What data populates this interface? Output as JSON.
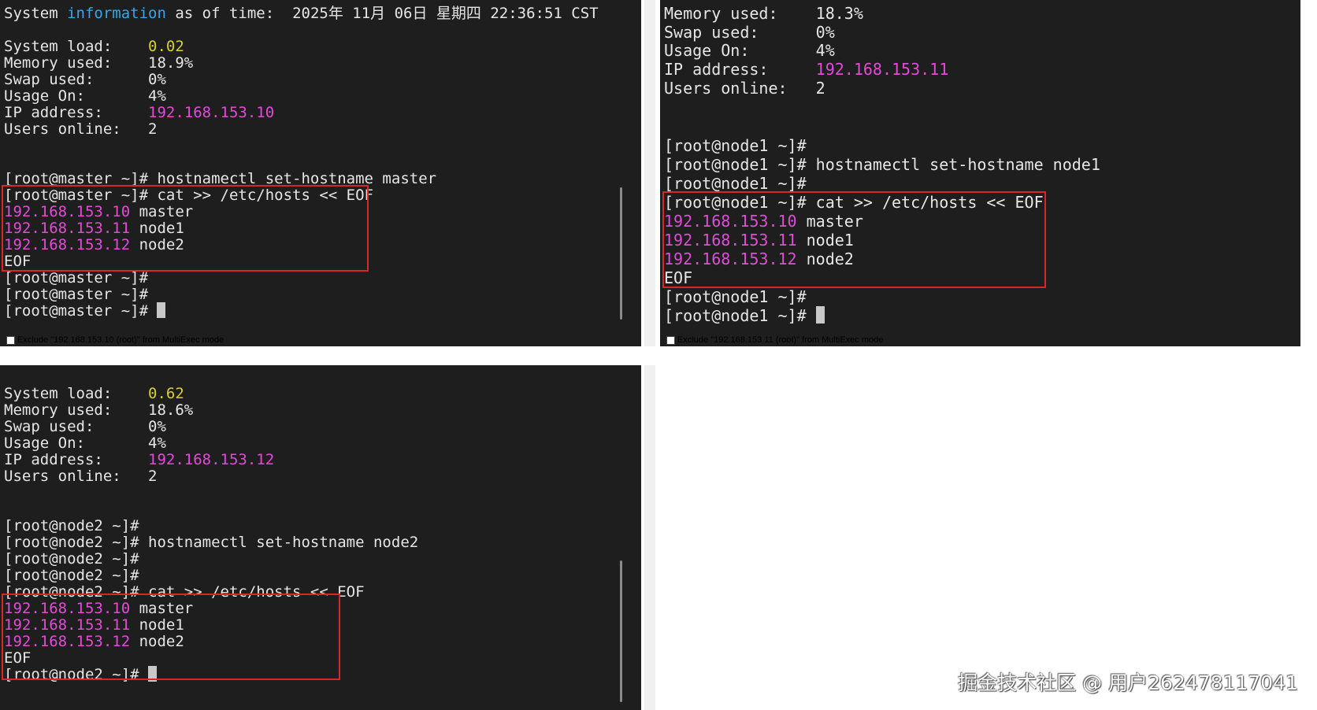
{
  "colors": {
    "terminal_bg": "#1e1e1e",
    "text": "#e6e6e6",
    "cyan": "#35a6e8",
    "yellow": "#d7d02e",
    "magenta": "#e24bd6",
    "highlight_box": "#d62828"
  },
  "terminals": {
    "master": {
      "sysinfo": {
        "prefix": "System ",
        "word": "information",
        "rest": " as of time:  2025年 11月 06日 星期四 22:36:51 CST"
      },
      "load_label": "System load:    ",
      "load_value": "0.02",
      "mem": "Memory used:    18.9%",
      "swap": "Swap used:      0%",
      "usage": "Usage On:       4%",
      "ip_label": "IP address:     ",
      "ip_value": "192.168.153.10",
      "users": "Users online:   2",
      "cmd_hostname": "[root@master ~]# hostnamectl set-hostname master",
      "cmd_cat": "[root@master ~]# cat >> /etc/hosts << EOF",
      "hosts": [
        {
          "ip": "192.168.153.10",
          "name": " master"
        },
        {
          "ip": "192.168.153.11",
          "name": " node1"
        },
        {
          "ip": "192.168.153.12",
          "name": " node2"
        }
      ],
      "eof": "EOF",
      "prompt": "[root@master ~]#",
      "prompt_last": "[root@master ~]# ",
      "exclude_label": "Exclude \"192.168.153.10 (root)\" from MultiExec mode"
    },
    "node1": {
      "mem": "Memory used:    18.3%",
      "swap": "Swap used:      0%",
      "usage": "Usage On:       4%",
      "ip_label": "IP address:     ",
      "ip_value": "192.168.153.11",
      "users": "Users online:   2",
      "prompt": "[root@node1 ~]#",
      "cmd_hostname": "[root@node1 ~]# hostnamectl set-hostname node1",
      "cmd_cat": "[root@node1 ~]# cat >> /etc/hosts << EOF",
      "hosts": [
        {
          "ip": "192.168.153.10",
          "name": " master"
        },
        {
          "ip": "192.168.153.11",
          "name": " node1"
        },
        {
          "ip": "192.168.153.12",
          "name": " node2"
        }
      ],
      "eof": "EOF",
      "prompt_last": "[root@node1 ~]# ",
      "exclude_label": "Exclude \"192.168.153.11 (root)\" from MultiExec mode"
    },
    "node2": {
      "load_label": "System load:    ",
      "load_value": "0.62",
      "mem": "Memory used:    18.6%",
      "swap": "Swap used:      0%",
      "usage": "Usage On:       4%",
      "ip_label": "IP address:     ",
      "ip_value": "192.168.153.12",
      "users": "Users online:   2",
      "prompt": "[root@node2 ~]#",
      "cmd_hostname": "[root@node2 ~]# hostnamectl set-hostname node2",
      "cmd_cat": "[root@node2 ~]# cat >> /etc/hosts << EOF",
      "hosts": [
        {
          "ip": "192.168.153.10",
          "name": " master"
        },
        {
          "ip": "192.168.153.11",
          "name": " node1"
        },
        {
          "ip": "192.168.153.12",
          "name": " node2"
        }
      ],
      "eof": "EOF",
      "prompt_last": "[root@node2 ~]# "
    }
  },
  "watermark": "掘金技术社区 @ 用户262478117041"
}
